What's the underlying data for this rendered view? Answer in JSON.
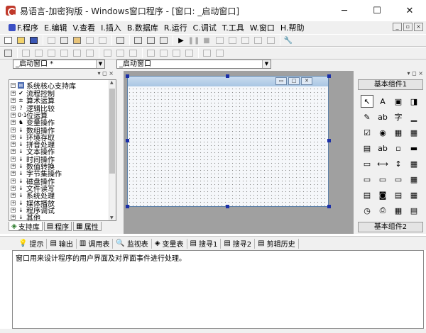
{
  "window": {
    "title": "易语言-加密狗版 - Windows窗口程序 - [窗口: _启动窗口]",
    "minimize": "─",
    "maximize": "☐",
    "close": "✕"
  },
  "menu": [
    {
      "label": "F.程序",
      "icon": "app-menu-icon"
    },
    {
      "label": "E.编辑"
    },
    {
      "label": "V.查看"
    },
    {
      "label": "I.插入"
    },
    {
      "label": "B.数据库"
    },
    {
      "label": "R.运行"
    },
    {
      "label": "C.调试"
    },
    {
      "label": "T.工具"
    },
    {
      "label": "W.窗口"
    },
    {
      "label": "H.帮助"
    }
  ],
  "mdi_buttons": [
    "_",
    "▫",
    "×"
  ],
  "combos": {
    "left": "_启动窗口 *",
    "right": "_启动窗口"
  },
  "panel_controls": {
    "left": "▾ ◻ ×",
    "right": "▾ ◻ ×"
  },
  "tree": {
    "root": "系统核心支持库",
    "items": [
      {
        "label": "流程控制",
        "icon": "✔"
      },
      {
        "label": "算术运算",
        "icon": "±"
      },
      {
        "label": "逻辑比较",
        "icon": "?"
      },
      {
        "label": "位运算",
        "icon": "0·1"
      },
      {
        "label": "变量操作",
        "icon": "♞"
      },
      {
        "label": "数组操作",
        "icon": "↓"
      },
      {
        "label": "环境存取",
        "icon": "↓"
      },
      {
        "label": "拼音处理",
        "icon": "↓"
      },
      {
        "label": "文本操作",
        "icon": "↓"
      },
      {
        "label": "时间操作",
        "icon": "↓"
      },
      {
        "label": "数值转换",
        "icon": "↓"
      },
      {
        "label": "字节集操作",
        "icon": "↓"
      },
      {
        "label": "磁盘操作",
        "icon": "↓"
      },
      {
        "label": "文件读写",
        "icon": "↓"
      },
      {
        "label": "系统处理",
        "icon": "↓"
      },
      {
        "label": "媒体播放",
        "icon": "↓"
      },
      {
        "label": "程序调试",
        "icon": "↓"
      },
      {
        "label": "其他",
        "icon": "↓"
      }
    ]
  },
  "left_tabs": [
    {
      "label": "支持库",
      "icon": "◈"
    },
    {
      "label": "程序",
      "icon": "▤"
    },
    {
      "label": "属性",
      "icon": "▦"
    }
  ],
  "form_buttons": [
    "▭",
    "□",
    "✕"
  ],
  "toolbox": {
    "caption_top": "基本组件1",
    "caption_bottom": "基本组件2",
    "items": [
      "↖",
      "A",
      "▣",
      "◨",
      "✎",
      "ab",
      "字",
      "▁",
      "☑",
      "◉",
      "▦",
      "▦",
      "▤",
      "ab",
      "▫",
      "▬",
      "▭",
      "⟷",
      "↕",
      "▦",
      "▭",
      "▭",
      "▭",
      "▦",
      "▤",
      "◙",
      "▤",
      "▦",
      "◷",
      "⎙",
      "▦",
      "▤"
    ]
  },
  "bottom_tabs": [
    {
      "label": "提示",
      "icon": "💡"
    },
    {
      "label": "输出",
      "icon": "▤"
    },
    {
      "label": "调用表",
      "icon": "▥"
    },
    {
      "label": "监视表",
      "icon": "🔍"
    },
    {
      "label": "变量表",
      "icon": "◈"
    },
    {
      "label": "搜寻1",
      "icon": "▤"
    },
    {
      "label": "搜寻2",
      "icon": "▤"
    },
    {
      "label": "剪辑历史",
      "icon": "▤"
    }
  ],
  "output_text": "窗口用来设计程序的用户界面及对界面事件进行处理。"
}
